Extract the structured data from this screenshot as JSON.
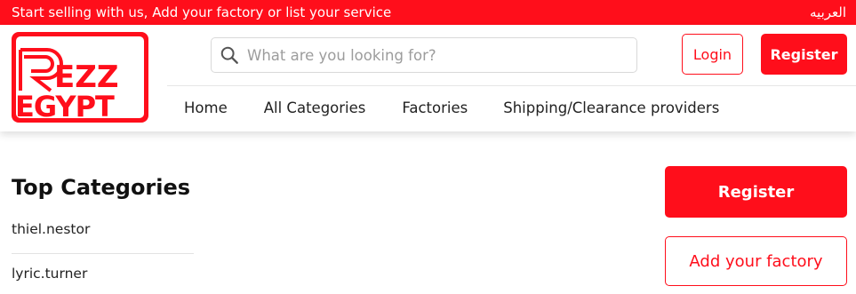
{
  "colors": {
    "brand": "#ff0e1b",
    "text": "#222222",
    "border": "#e3e3e3"
  },
  "topbar": {
    "promo_text": "Start selling with us, Add your factory or list your service",
    "language_link": "العربيه"
  },
  "header": {
    "logo_icon": "rezz-egypt-logo",
    "search": {
      "placeholder": "What are you looking for?",
      "value": "",
      "icon": "search-icon"
    },
    "login_label": "Login",
    "register_label": "Register"
  },
  "nav": {
    "items": [
      {
        "label": "Home"
      },
      {
        "label": "All Categories"
      },
      {
        "label": "Factories"
      },
      {
        "label": "Shipping/Clearance providers"
      }
    ]
  },
  "main": {
    "section_title": "Top Categories",
    "categories": [
      {
        "label": "thiel.nestor"
      },
      {
        "label": "lyric.turner"
      }
    ]
  },
  "sidebar": {
    "register_label": "Register",
    "add_factory_label": "Add your factory"
  }
}
